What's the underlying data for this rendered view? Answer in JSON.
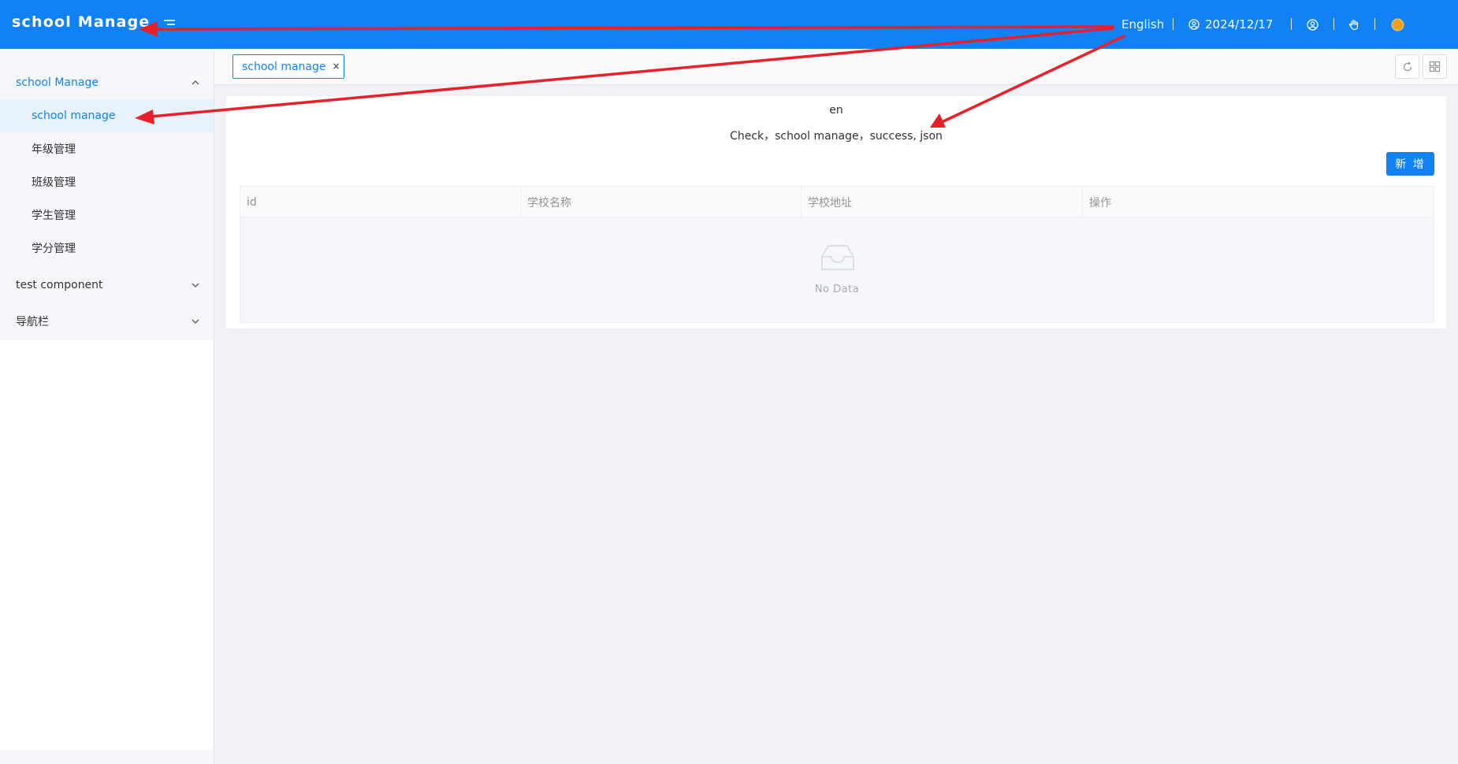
{
  "header": {
    "title": "school Manage",
    "language": "English",
    "date": "2024/12/17",
    "bg_color": "#1082f6"
  },
  "sidebar": {
    "groups": [
      {
        "label": "school Manage",
        "expanded": true,
        "items": [
          {
            "label": "school manage",
            "active": true
          },
          {
            "label": "年级管理"
          },
          {
            "label": "班级管理"
          },
          {
            "label": "学生管理"
          },
          {
            "label": "学分管理"
          }
        ]
      },
      {
        "label": "test component",
        "expanded": false
      },
      {
        "label": "导航栏",
        "expanded": false
      }
    ]
  },
  "tabs": [
    {
      "label": "school manage",
      "close": "×"
    }
  ],
  "main": {
    "lang_code": "en",
    "check_text": "Check，school manage，success, json",
    "add_button": "新 增",
    "table": {
      "columns": [
        "id",
        "学校名称",
        "学校地址",
        "操作"
      ],
      "rows": [],
      "empty_text": "No Data"
    }
  },
  "colors": {
    "primary": "#1082f6",
    "annotation_arrow": "#e8202a",
    "theme_dot": "#f0a020"
  }
}
